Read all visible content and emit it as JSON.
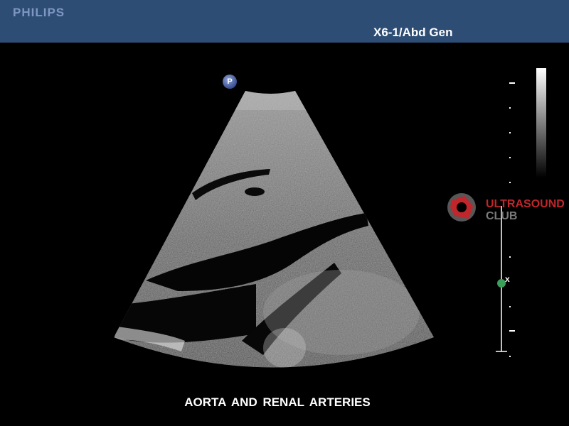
{
  "header": {
    "brand": "PHILIPS",
    "probe_preset": "X6-1/Abd Gen"
  },
  "image": {
    "marker_label": "P",
    "caption": "AORTA AND RENAL ARTERIES"
  },
  "watermark": {
    "line1": "ULTRASOUND",
    "line2": "CLUB",
    "primary_color": "#c0262b",
    "secondary_color": "#7a7a7a"
  },
  "depth_scale": {
    "focus_marker": "x",
    "focus_color": "#3aa05a"
  },
  "colors": {
    "header_bg": "#2e4d75",
    "brand_color": "#7d97c2"
  }
}
